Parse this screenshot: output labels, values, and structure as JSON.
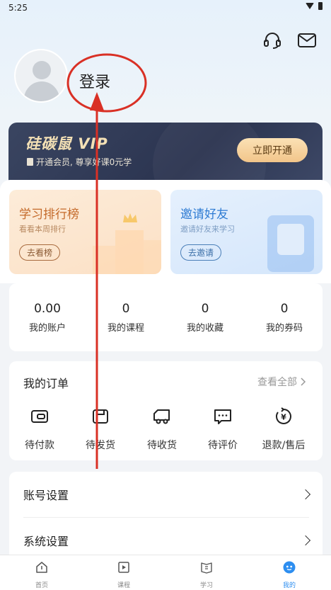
{
  "status_bar": {
    "time": "5:25"
  },
  "user": {
    "login_label": "登录"
  },
  "vip": {
    "title": "硅碳鼠 VIP",
    "subtitle": "开通会员, 尊享好课0元学",
    "button_label": "立即开通"
  },
  "promo": {
    "rank": {
      "title": "学习排行榜",
      "subtitle": "看看本周排行",
      "button_label": "去看榜"
    },
    "invite": {
      "title": "邀请好友",
      "subtitle": "邀请好友来学习",
      "button_label": "去邀请"
    }
  },
  "stats": [
    {
      "value": "0.00",
      "label": "我的账户"
    },
    {
      "value": "0",
      "label": "我的课程"
    },
    {
      "value": "0",
      "label": "我的收藏"
    },
    {
      "value": "0",
      "label": "我的券码"
    }
  ],
  "orders": {
    "title": "我的订单",
    "view_all": "查看全部",
    "items": [
      {
        "label": "待付款",
        "icon": "wallet-icon"
      },
      {
        "label": "待发货",
        "icon": "box-icon"
      },
      {
        "label": "待收货",
        "icon": "truck-icon"
      },
      {
        "label": "待评价",
        "icon": "comment-icon"
      },
      {
        "label": "退款/售后",
        "icon": "refund-icon"
      }
    ]
  },
  "settings": [
    {
      "label": "账号设置"
    },
    {
      "label": "系统设置"
    }
  ],
  "tabbar": [
    {
      "label": "首页",
      "icon": "home-icon"
    },
    {
      "label": "课程",
      "icon": "course-icon"
    },
    {
      "label": "学习",
      "icon": "study-icon"
    },
    {
      "label": "我的",
      "icon": "profile-icon",
      "active": true
    }
  ],
  "colors": {
    "accent": "#2d8ef0",
    "annotation": "#d93025",
    "vip_bg": "#2b3450",
    "vip_gold": "#f3e0b5"
  }
}
